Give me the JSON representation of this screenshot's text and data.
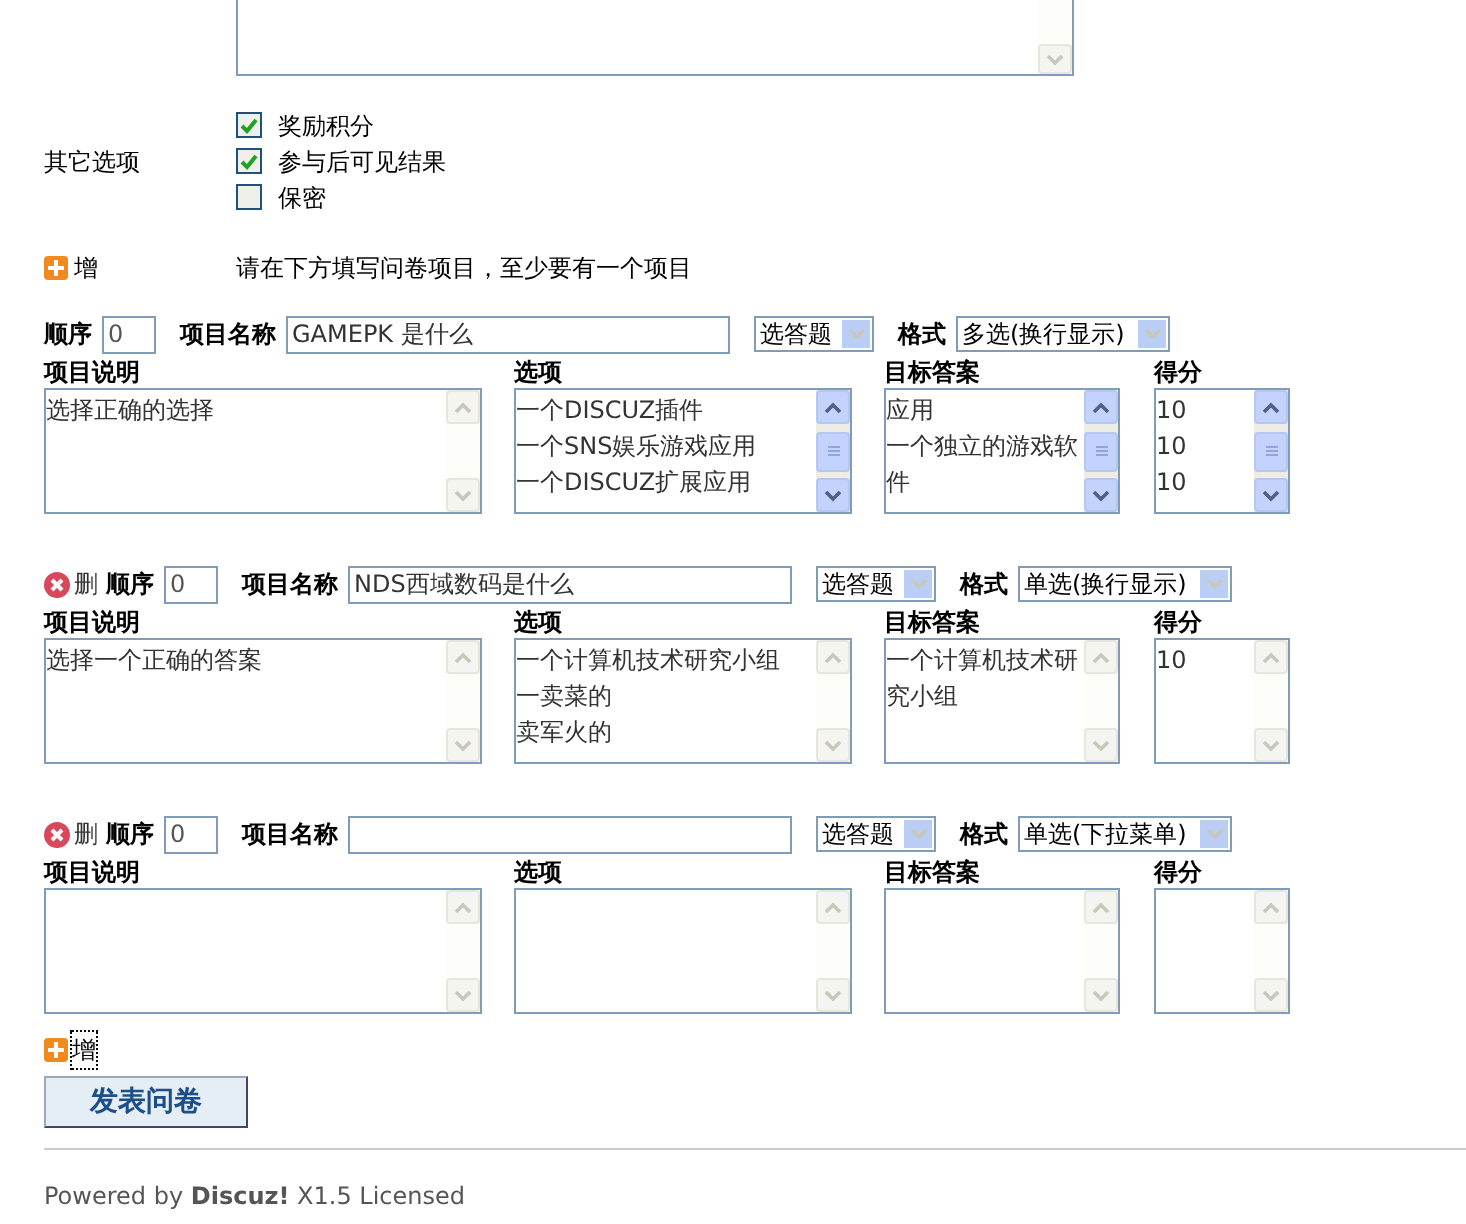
{
  "other_options": {
    "label": "其它选项",
    "items": [
      {
        "label": "奖励积分",
        "checked": true
      },
      {
        "label": "参与后可见结果",
        "checked": true
      },
      {
        "label": "保密",
        "checked": false
      }
    ]
  },
  "add_top": {
    "label": "增",
    "hint": "请在下方填写问卷项目，至少要有一个项目"
  },
  "questions": [
    {
      "deletable": false,
      "order_label": "顺序",
      "order": "0",
      "name_label": "项目名称",
      "name": "GAMEPK 是什么",
      "type": "选答题",
      "format_label": "格式",
      "format": "多选(换行显示)",
      "fields": [
        {
          "header": "项目说明",
          "lines": [
            "选择正确的选择"
          ],
          "scrolled": false
        },
        {
          "header": "选项",
          "lines": [
            "一个DISCUZ插件",
            "一个SNS娱乐游戏应用",
            "一个DISCUZ扩展应用"
          ],
          "scrolled": true
        },
        {
          "header": "目标答案",
          "lines": [
            "应用",
            "一个独立的游戏软件"
          ],
          "scrolled": true
        },
        {
          "header": "得分",
          "lines": [
            "10",
            "10",
            "10"
          ],
          "scrolled": true
        }
      ]
    },
    {
      "deletable": true,
      "delete_label": "删",
      "order_label": "顺序",
      "order": "0",
      "name_label": "项目名称",
      "name": "NDS西域数码是什么",
      "type": "选答题",
      "format_label": "格式",
      "format": "单选(换行显示)",
      "fields": [
        {
          "header": "项目说明",
          "lines": [
            "选择一个正确的答案"
          ],
          "scrolled": false
        },
        {
          "header": "选项",
          "lines": [
            "一个计算机技术研究小组",
            "一卖菜的",
            "卖军火的"
          ],
          "scrolled": false
        },
        {
          "header": "目标答案",
          "lines": [
            "一个计算机技术研究小组"
          ],
          "scrolled": false
        },
        {
          "header": "得分",
          "lines": [
            "10"
          ],
          "scrolled": false
        }
      ]
    },
    {
      "deletable": true,
      "delete_label": "删",
      "order_label": "顺序",
      "order": "0",
      "name_label": "项目名称",
      "type": "选答题",
      "format_label": "格式",
      "format": "单选(下拉菜单)",
      "fields": [
        {
          "header": "项目说明",
          "scrolled": false
        },
        {
          "header": "选项",
          "scrolled": false
        },
        {
          "header": "目标答案",
          "scrolled": false
        },
        {
          "header": "得分",
          "scrolled": false
        }
      ]
    }
  ],
  "add_bottom": {
    "label": "增"
  },
  "submit": {
    "label": "发表问卷"
  },
  "footer": {
    "powered": "Powered by **Discuz!** X1.5 Licensed"
  }
}
